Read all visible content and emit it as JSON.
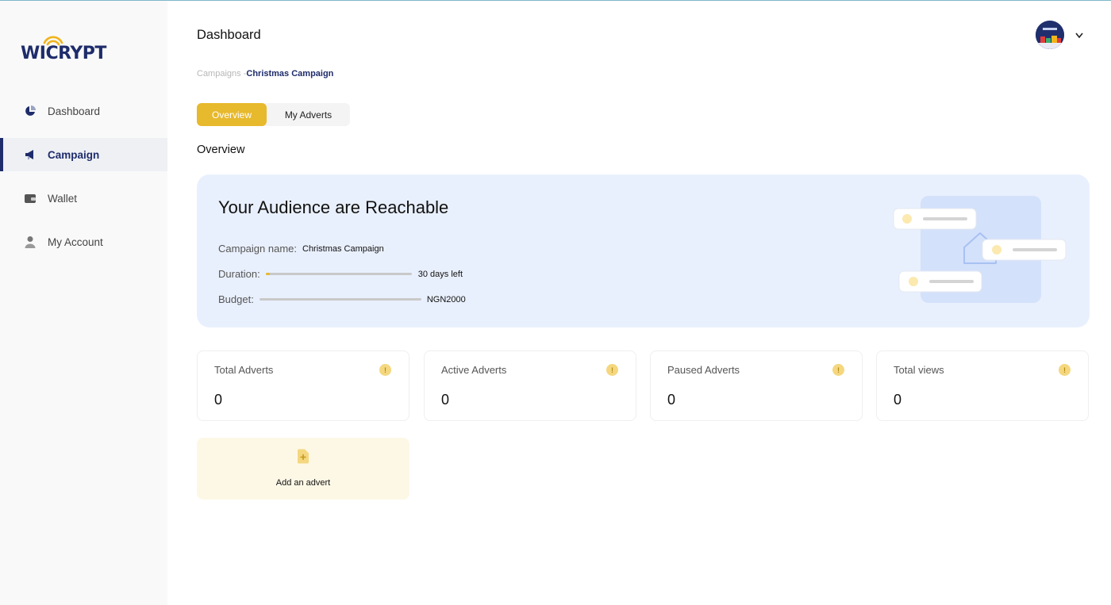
{
  "app": {
    "brand": "WICRYPT",
    "accent_color": "#e7b92c",
    "brand_color": "#1e2c6b"
  },
  "sidebar": {
    "items": [
      {
        "label": "Dashboard",
        "icon": "pie-chart-icon",
        "active": false
      },
      {
        "label": "Campaign",
        "icon": "megaphone-icon",
        "active": true
      },
      {
        "label": "Wallet",
        "icon": "wallet-icon",
        "active": false
      },
      {
        "label": "My Account",
        "icon": "user-icon",
        "active": false
      }
    ]
  },
  "header": {
    "title": "Dashboard",
    "avatar": "avatar-image",
    "menu": "chevron-down-icon"
  },
  "breadcrumb": {
    "parent": "Campaigns",
    "separator": " -",
    "current": "Christmas Campaign"
  },
  "tabs": [
    {
      "label": "Overview",
      "active": true
    },
    {
      "label": "My Adverts",
      "active": false
    }
  ],
  "section_title": "Overview",
  "hero": {
    "title": "Your Audience are Reachable",
    "campaign_label": "Campaign name:",
    "campaign_value": "Christmas Campaign",
    "duration_label": "Duration:",
    "duration_value": "30 days left",
    "duration_progress": 0.03,
    "budget_label": "Budget:",
    "budget_value": "NGN2000",
    "budget_progress": 0
  },
  "stats": [
    {
      "label": "Total Adverts",
      "value": "0",
      "info": "!"
    },
    {
      "label": "Active Adverts",
      "value": "0",
      "info": "!"
    },
    {
      "label": "Paused Adverts",
      "value": "0",
      "info": "!"
    },
    {
      "label": "Total views",
      "value": "0",
      "info": "!"
    }
  ],
  "add_advert": {
    "label": "Add an advert",
    "icon": "add-file-icon"
  }
}
